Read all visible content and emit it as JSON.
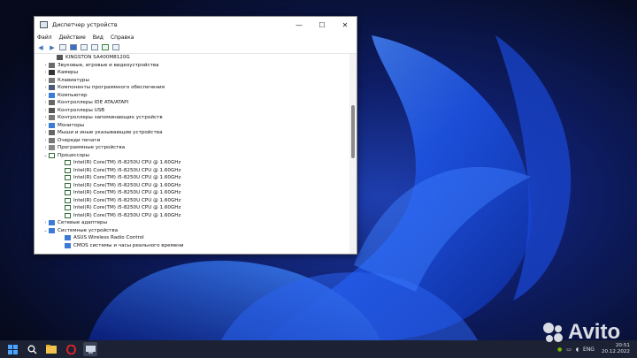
{
  "window": {
    "title": "Диспетчер устройств",
    "minimize": "—",
    "maximize": "☐",
    "close": "✕"
  },
  "menu": [
    "Файл",
    "Действие",
    "Вид",
    "Справка"
  ],
  "tree": [
    {
      "indent": 2,
      "arrow": "",
      "icon": "disk-icon",
      "color": "#555555",
      "label": "KINGSTON SA400M8120G"
    },
    {
      "indent": 1,
      "arrow": "›",
      "icon": "sound-icon",
      "color": "#6b6b6b",
      "label": "Звуковые, игровые и видеоустройства"
    },
    {
      "indent": 1,
      "arrow": "›",
      "icon": "camera-icon",
      "color": "#333333",
      "label": "Камеры"
    },
    {
      "indent": 1,
      "arrow": "›",
      "icon": "keyboard-icon",
      "color": "#777777",
      "label": "Клавиатуры"
    },
    {
      "indent": 1,
      "arrow": "›",
      "icon": "software-component-icon",
      "color": "#4a5a7a",
      "label": "Компоненты программного обеспечения"
    },
    {
      "indent": 1,
      "arrow": "›",
      "icon": "computer-icon",
      "color": "#3b7bd6",
      "label": "Компьютер"
    },
    {
      "indent": 1,
      "arrow": "›",
      "icon": "ide-controller-icon",
      "color": "#666666",
      "label": "Контроллеры IDE ATA/ATAPI"
    },
    {
      "indent": 1,
      "arrow": "›",
      "icon": "usb-icon",
      "color": "#555555",
      "label": "Контроллеры USB"
    },
    {
      "indent": 1,
      "arrow": "›",
      "icon": "storage-controller-icon",
      "color": "#777777",
      "label": "Контроллеры запоминающих устройств"
    },
    {
      "indent": 1,
      "arrow": "›",
      "icon": "monitor-icon",
      "color": "#3b7bd6",
      "label": "Мониторы"
    },
    {
      "indent": 1,
      "arrow": "›",
      "icon": "mouse-icon",
      "color": "#666666",
      "label": "Мыши и иные указывающие устройства"
    },
    {
      "indent": 1,
      "arrow": "›",
      "icon": "print-queue-icon",
      "color": "#777777",
      "label": "Очереди печати"
    },
    {
      "indent": 1,
      "arrow": "›",
      "icon": "software-device-icon",
      "color": "#888888",
      "label": "Программные устройства"
    },
    {
      "indent": 1,
      "arrow": "⌄",
      "icon": "processor-icon",
      "color": "#2f6b3a",
      "label": "Процессоры"
    },
    {
      "indent": 3,
      "arrow": "",
      "icon": "cpu-icon",
      "color": "#2f6b3a",
      "label": "Intel(R) Core(TM) i5-8250U CPU @ 1.60GHz"
    },
    {
      "indent": 3,
      "arrow": "",
      "icon": "cpu-icon",
      "color": "#2f6b3a",
      "label": "Intel(R) Core(TM) i5-8250U CPU @ 1.60GHz"
    },
    {
      "indent": 3,
      "arrow": "",
      "icon": "cpu-icon",
      "color": "#2f6b3a",
      "label": "Intel(R) Core(TM) i5-8250U CPU @ 1.60GHz"
    },
    {
      "indent": 3,
      "arrow": "",
      "icon": "cpu-icon",
      "color": "#2f6b3a",
      "label": "Intel(R) Core(TM) i5-8250U CPU @ 1.60GHz"
    },
    {
      "indent": 3,
      "arrow": "",
      "icon": "cpu-icon",
      "color": "#2f6b3a",
      "label": "Intel(R) Core(TM) i5-8250U CPU @ 1.60GHz"
    },
    {
      "indent": 3,
      "arrow": "",
      "icon": "cpu-icon",
      "color": "#2f6b3a",
      "label": "Intel(R) Core(TM) i5-8250U CPU @ 1.60GHz"
    },
    {
      "indent": 3,
      "arrow": "",
      "icon": "cpu-icon",
      "color": "#2f6b3a",
      "label": "Intel(R) Core(TM) i5-8250U CPU @ 1.60GHz"
    },
    {
      "indent": 3,
      "arrow": "",
      "icon": "cpu-icon",
      "color": "#2f6b3a",
      "label": "Intel(R) Core(TM) i5-8250U CPU @ 1.60GHz"
    },
    {
      "indent": 1,
      "arrow": "›",
      "icon": "network-adapter-icon",
      "color": "#3b7bd6",
      "label": "Сетевые адаптеры"
    },
    {
      "indent": 1,
      "arrow": "⌄",
      "icon": "system-device-icon",
      "color": "#3b7bd6",
      "label": "Системные устройства"
    },
    {
      "indent": 3,
      "arrow": "",
      "icon": "system-device-icon",
      "color": "#3b7bd6",
      "label": "ASUS Wireless Radio Control"
    },
    {
      "indent": 3,
      "arrow": "",
      "icon": "system-device-icon",
      "color": "#3b7bd6",
      "label": "CMOS системы и часы реального времени"
    }
  ],
  "taskbar": {
    "lang": "ENG",
    "time": "20:51",
    "date": "20.12.2022"
  },
  "watermark": "Avito"
}
